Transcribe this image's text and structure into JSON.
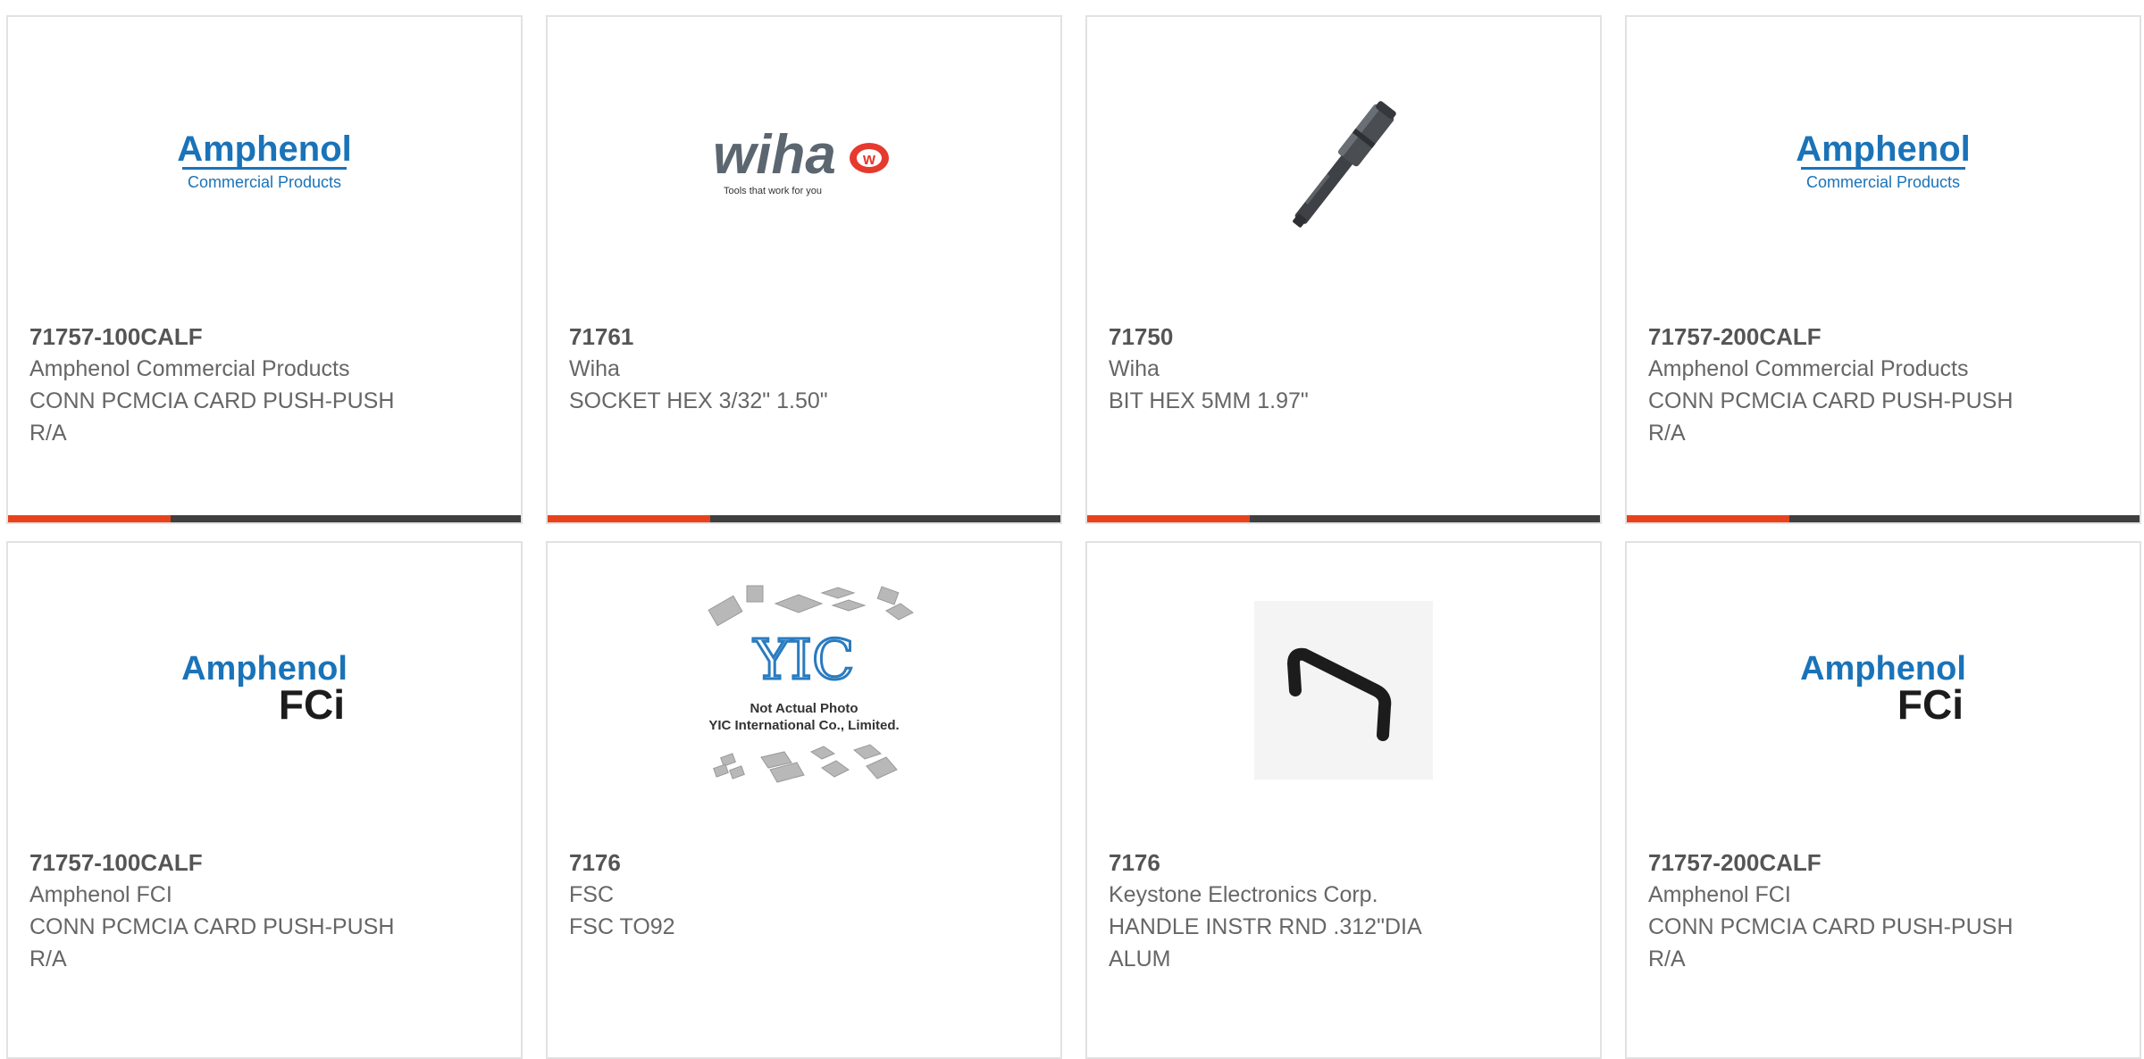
{
  "accent_color": "#e8421c",
  "bar_color": "#3f3f3f",
  "products": [
    {
      "part_number": "71757-100CALF",
      "manufacturer": "Amphenol Commercial Products",
      "description": "CONN PCMCIA CARD PUSH-PUSH R/A",
      "image": {
        "type": "logo-amphenol-commercial",
        "line1": "Amphenol",
        "line2": "Commercial Products"
      }
    },
    {
      "part_number": "71761",
      "manufacturer": "Wiha",
      "description": "SOCKET HEX 3/32\" 1.50\"",
      "image": {
        "type": "logo-wiha",
        "line1": "wiha",
        "line2": "Tools that work for you"
      }
    },
    {
      "part_number": "71750",
      "manufacturer": "Wiha",
      "description": "BIT HEX 5MM 1.97\"",
      "image": {
        "type": "photo-hex-bit"
      }
    },
    {
      "part_number": "71757-200CALF",
      "manufacturer": "Amphenol Commercial Products",
      "description": "CONN PCMCIA CARD PUSH-PUSH R/A",
      "image": {
        "type": "logo-amphenol-commercial",
        "line1": "Amphenol",
        "line2": "Commercial Products"
      }
    },
    {
      "part_number": "71757-100CALF",
      "manufacturer": "Amphenol FCI",
      "description": "CONN PCMCIA CARD PUSH-PUSH R/A",
      "image": {
        "type": "logo-amphenol-fci",
        "line1": "Amphenol",
        "line2": "FCi"
      }
    },
    {
      "part_number": "7176",
      "manufacturer": "FSC",
      "description": "FSC TO92",
      "image": {
        "type": "placeholder-yic",
        "logo": "YIC",
        "line1": "Not Actual Photo",
        "line2": "YIC International Co., Limited."
      }
    },
    {
      "part_number": "7176",
      "manufacturer": "Keystone Electronics Corp.",
      "description": "HANDLE INSTR RND .312\"DIA ALUM",
      "image": {
        "type": "photo-handle"
      }
    },
    {
      "part_number": "71757-200CALF",
      "manufacturer": "Amphenol FCI",
      "description": "CONN PCMCIA CARD PUSH-PUSH R/A",
      "image": {
        "type": "logo-amphenol-fci",
        "line1": "Amphenol",
        "line2": "FCi"
      }
    }
  ]
}
